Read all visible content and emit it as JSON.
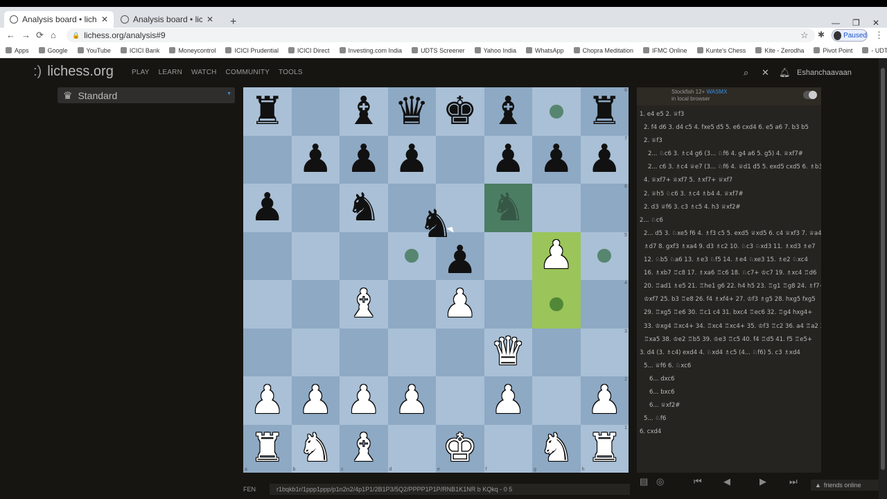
{
  "browser": {
    "tabs": [
      {
        "title": "Analysis board • lichess.org",
        "active": true
      },
      {
        "title": "Analysis board • lichess.org",
        "active": false
      }
    ],
    "new_tab": "+",
    "minimize": "—",
    "maximize": "❐",
    "close": "✕",
    "back": "←",
    "forward": "→",
    "reload": "⟳",
    "home": "⌂",
    "url": "lichess.org/analysis#9",
    "profile_status": "Paused",
    "bookmarks": [
      "Apps",
      "Google",
      "YouTube",
      "ICICI Bank",
      "Moneycontrol",
      "ICICI Prudential",
      "ICICI Direct",
      "Investing.com India",
      "UDTS Screener",
      "Yahoo India",
      "WhatsApp",
      "Chopra Meditation",
      "IFMC Online",
      "Kunte's Chess",
      "Kite - Zerodha",
      "Pivot Point",
      "- UDTS Intraday"
    ]
  },
  "site": {
    "logo_face": ":)",
    "logo": "lichess.org",
    "nav": [
      "PLAY",
      "LEARN",
      "WATCH",
      "COMMUNITY",
      "TOOLS"
    ],
    "username": "Eshanchaavaan"
  },
  "variant": {
    "label": "Standard",
    "icon": "crown-icon"
  },
  "board": {
    "colors": {
      "light": "#a9c0d6",
      "dark": "#8ea9c4",
      "highlight": "#9bc55a",
      "selected": "#4b7d63"
    },
    "rows": [
      [
        "bR",
        "",
        "bB",
        "bQ",
        "bK",
        "bB",
        "",
        "bR"
      ],
      [
        "",
        "bP",
        "bP",
        "bP",
        "",
        "bP",
        "bP",
        "bP"
      ],
      [
        "bP",
        "",
        "bN",
        "",
        "",
        "bN*",
        "",
        ""
      ],
      [
        "",
        "",
        "",
        "",
        "",
        "",
        "wP",
        ""
      ],
      [
        "",
        "",
        "wB",
        "",
        "wP",
        "",
        "",
        ""
      ],
      [
        "",
        "",
        "",
        "",
        "",
        "wQ",
        "",
        ""
      ],
      [
        "wP",
        "wP",
        "wP",
        "wP",
        "",
        "wP",
        "",
        "wP"
      ],
      [
        "wR",
        "wN",
        "wB",
        "",
        "wK",
        "",
        "wN",
        "wR"
      ]
    ],
    "dots": [
      [
        0,
        6
      ],
      [
        3,
        3
      ],
      [
        3,
        7
      ],
      [
        4,
        6
      ]
    ],
    "highlights": [
      [
        3,
        6
      ],
      [
        4,
        6
      ]
    ],
    "selected": [
      [
        2,
        5
      ]
    ],
    "floating_piece": "bN",
    "under_floater": "bP",
    "rank_labels": [
      "8",
      "7",
      "6",
      "5",
      "4",
      "3",
      "2",
      "1"
    ],
    "file_labels": [
      "a",
      "b",
      "c",
      "d",
      "e",
      "f",
      "g",
      "h"
    ]
  },
  "fen": {
    "label": "FEN",
    "value": "r1bqkb1r/1ppp1ppp/p1n2n2/4p1P1/2B1P3/5Q2/PPPP1P1P/RNB1K1NR b KQkq - 0 5"
  },
  "engine": {
    "name": "Stockfish 12+",
    "tag": "WASMX",
    "sub": "in local browser"
  },
  "moves": [
    {
      "cls": "",
      "text": "1. e4 e5 2. ♕f3"
    },
    {
      "cls": "i1",
      "text": "2. f4 d6 3. d4 c5 4. fxe5 d5 5. e6 cxd4 6. e5 a6 7. b3 b5"
    },
    {
      "cls": "i1",
      "text": "2. ♕f3"
    },
    {
      "cls": "i2",
      "text": "2... ♘c6 3. ♗c4 g6 (3... ♘f6 4. g4 a6 5. g5) 4. ♕xf7#"
    },
    {
      "cls": "i2",
      "text": "2... c6 3. ♗c4 ♕e7 (3... ♘f6 4. ♕d1 d5 5. exd5 cxd5 6. ♗b3)"
    },
    {
      "cls": "i1",
      "text": "4. ♕xf7+ ♕xf7 5. ♗xf7+ ♕xf7"
    },
    {
      "cls": "i1",
      "text": "2. ♕h5 ♘c6 3. ♗c4 ♗b4 4. ♕xf7#"
    },
    {
      "cls": "i1",
      "text": "2. d3 ♕f6 3. c3 ♗c5 4. h3 ♕xf2#"
    },
    {
      "cls": "",
      "text": "2... ♘c6"
    },
    {
      "cls": "i1",
      "text": "2... d5 3. ♘xe5 f6 4. ♗f3 c5 5. exd5 ♕xd5 6. c4 ♕xf3 7. ♕a4+"
    },
    {
      "cls": "i1",
      "text": "♗d7 8. gxf3 ♗xa4 9. d3 ♗c2 10. ♘c3 ♘xd3 11. ♗xd3 ♗e7"
    },
    {
      "cls": "i1",
      "text": "12. ♘b5 ♘a6 13. ♗e3 ♘f5 14. ♗e4 ♘xe3 15. ♗e2 ♘xc4"
    },
    {
      "cls": "i1",
      "text": "16. ♗xb7 ♖c8 17. ♗xa6 ♖c6 18. ♘c7+ ♔c7 19. ♗xc4 ♖d6"
    },
    {
      "cls": "i1",
      "text": "20. ♖ad1 ♗e5 21. ♖he1 g6 22. h4 h5 23. ♖g1 ♖g8 24. ♗f7+"
    },
    {
      "cls": "i1",
      "text": "♔xf7 25. b3 ♖e8 26. f4 ♗xf4+ 27. ♔f3 ♗g5 28. hxg5 fxg5"
    },
    {
      "cls": "i1",
      "text": "29. ♖xg5 ♖e6 30. ♖c1 c4 31. bxc4 ♖ec6 32. ♖g4 hxg4+"
    },
    {
      "cls": "i1",
      "text": "33. ♔xg4 ♖xc4+ 34. ♖xc4 ♖xc4+ 35. ♔f3 ♖c2 36. a4 ♖a2 37. a5"
    },
    {
      "cls": "i1",
      "text": "♖xa5 38. ♔e2 ♖b5 39. ♔e3 ♖c5 40. f4 ♖d5 41. f5 ♖e5+"
    },
    {
      "cls": "",
      "text": "3. d4 (3. ♗c4) exd4 4. ♘xd4 ♗c5 (4... ♘f6) 5. c3 ♗xd4"
    },
    {
      "cls": "i1",
      "text": "5... ♕f6 6. ♘xc6"
    },
    {
      "cls": "i3",
      "text": "6... dxc6"
    },
    {
      "cls": "i3",
      "text": "6... bxc6"
    },
    {
      "cls": "i3",
      "text": "6... ♕xf2#"
    },
    {
      "cls": "i1",
      "text": "5... ♘f6"
    },
    {
      "cls": "",
      "text": "6. cxd4"
    }
  ],
  "controls": {
    "first": "⏮",
    "prev": "◀",
    "next": "▶",
    "last": "⏭"
  },
  "friends": "friends online"
}
